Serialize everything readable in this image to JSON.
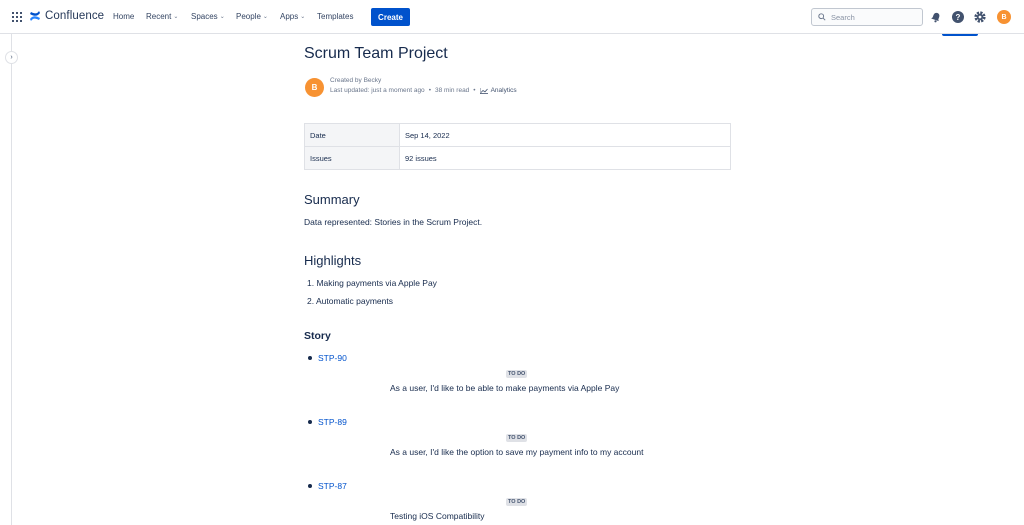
{
  "nav": {
    "brand": "Confluence",
    "items": [
      {
        "label": "Home"
      },
      {
        "label": "Recent"
      },
      {
        "label": "Spaces"
      },
      {
        "label": "People"
      },
      {
        "label": "Apps"
      },
      {
        "label": "Templates"
      }
    ],
    "create_label": "Create",
    "search_placeholder": "Search",
    "avatar_initial": "B"
  },
  "page": {
    "title": "Scrum Team Project",
    "created_by": "Created by Becky",
    "last_updated": "Last updated: just a moment ago",
    "read_time": "38 min read",
    "analytics_label": "Analytics",
    "author_initial": "B"
  },
  "meta_table": [
    {
      "key": "Date",
      "value": "Sep 14, 2022"
    },
    {
      "key": "Issues",
      "value": "92 issues"
    }
  ],
  "summary": {
    "heading": "Summary",
    "text": "Data represented: Stories in the Scrum Project."
  },
  "highlights": {
    "heading": "Highlights",
    "items": [
      "1. Making payments via Apple Pay",
      "2. Automatic payments"
    ]
  },
  "story": {
    "heading": "Story",
    "items": [
      {
        "key": "STP-90",
        "status": "TO DO",
        "description": "As a user, I'd like to be able to make payments via Apple Pay"
      },
      {
        "key": "STP-89",
        "status": "TO DO",
        "description": "As a user, I'd like the option to save my payment info to my account"
      },
      {
        "key": "STP-87",
        "status": "TO DO",
        "description": "Testing iOS Compatibility"
      }
    ]
  },
  "colors": {
    "accent": "#0052cc",
    "avatar": "#f79232",
    "text": "#172b4d"
  }
}
